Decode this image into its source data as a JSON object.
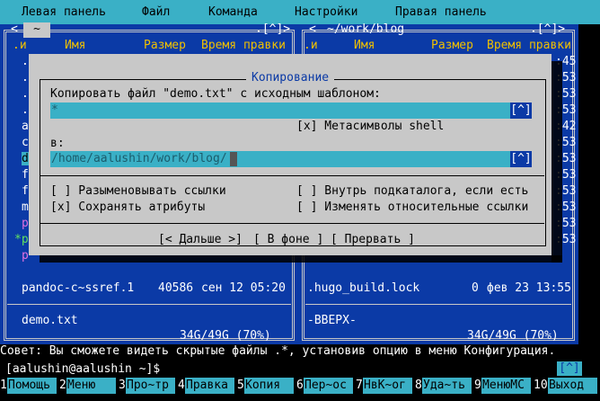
{
  "menu": {
    "items": [
      "Левая панель",
      "Файл",
      "Команда",
      "Настройки",
      "Правая панель"
    ]
  },
  "left_panel": {
    "path": "~",
    "history_btn": ".[^]>",
    "back_btn": "<",
    "headers": {
      "sort": ".и",
      "name": "Имя",
      "size": "Размер",
      "mtime": "Время правки"
    },
    "visible_rows": [
      {
        "name": "pandoc-c~ssref.1",
        "size": "40586",
        "mtime": "сен 12 05:20"
      }
    ],
    "left_glyphs": [
      ".",
      ".",
      ".",
      ".",
      "a",
      "c",
      "d",
      "f",
      "f",
      "m",
      "p",
      "*p",
      "p"
    ],
    "selected_file": "demo.txt",
    "disk": "34G/49G (70%)"
  },
  "right_panel": {
    "path": "~/work/blog",
    "history_btn": ".[^]>",
    "back_btn": "<",
    "headers": {
      "sort": ".и",
      "name": "Имя",
      "size": "Размер",
      "mtime": "Время правки"
    },
    "right_glyphs": [
      ":45",
      ":53",
      ":53",
      ":53",
      ":42",
      ":53",
      ":53",
      ":53",
      ":53",
      ":53",
      ":53",
      ":53"
    ],
    "visible_rows": [
      {
        "name": ".hugo_build.lock",
        "size": "0",
        "mtime": "фев 23 13:55"
      }
    ],
    "selected_file": "-ВВЕРХ-",
    "disk": "34G/49G (70%)"
  },
  "dialog": {
    "title": "Копирование",
    "source_label": "Копировать файл \"demo.txt\" с исходным шаблоном:",
    "source_value": "*",
    "history_btn": "[^]",
    "shell_checkbox": "[x] Метасимволы shell",
    "dest_label": "в:",
    "dest_value": "/home/aalushin/work/blog/",
    "options_left": [
      "[ ] Разыменовывать ссылки",
      "[x] Сохранять атрибуты"
    ],
    "options_right": [
      "[ ] Внутрь подкаталога, если есть",
      "[ ] Изменять относительные ссылки"
    ],
    "buttons": [
      "[< Дальше >]",
      "[ В фоне ]",
      "[ Прервать ]"
    ]
  },
  "hint": "Совет: Вы сможете видеть скрытые файлы .*, установив опцию в меню Конфигурация.",
  "command_line": {
    "prompt": "[aalushin@aalushin ~]$",
    "history_btn": "[^]"
  },
  "keybar": [
    {
      "num": "1",
      "label": "Помощь"
    },
    {
      "num": "2",
      "label": "Меню"
    },
    {
      "num": "3",
      "label": "Про~тр"
    },
    {
      "num": "4",
      "label": "Правка"
    },
    {
      "num": "5",
      "label": "Копия"
    },
    {
      "num": "6",
      "label": "Пер~ос"
    },
    {
      "num": "7",
      "label": "НвК~ог"
    },
    {
      "num": "8",
      "label": "Уда~ть"
    },
    {
      "num": "9",
      "label": "МенюМС"
    },
    {
      "num": "10",
      "label": "Выход"
    }
  ],
  "colors": {
    "panel": "#0b3aa6",
    "accent": "#3ab0c6",
    "dialog": "#c8c8c8",
    "header": "#f0c000"
  }
}
